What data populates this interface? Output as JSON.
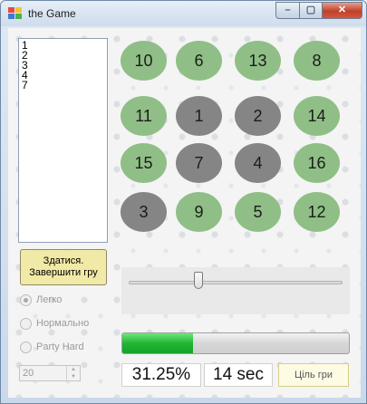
{
  "window": {
    "title": "the Game",
    "minimize_label": "–",
    "maximize_label": "▢",
    "close_label": "✕"
  },
  "moves_list": [
    "1",
    "2",
    "3",
    "4",
    "7"
  ],
  "board": {
    "tiles": [
      {
        "label": "10",
        "state": "active"
      },
      {
        "label": "6",
        "state": "active"
      },
      {
        "label": "13",
        "state": "active"
      },
      {
        "label": "8",
        "state": "active"
      },
      {
        "label": "11",
        "state": "active"
      },
      {
        "label": "1",
        "state": "placed"
      },
      {
        "label": "2",
        "state": "placed"
      },
      {
        "label": "14",
        "state": "active"
      },
      {
        "label": "15",
        "state": "active"
      },
      {
        "label": "7",
        "state": "placed"
      },
      {
        "label": "4",
        "state": "placed"
      },
      {
        "label": "16",
        "state": "active"
      },
      {
        "label": "3",
        "state": "placed"
      },
      {
        "label": "9",
        "state": "active"
      },
      {
        "label": "5",
        "state": "active"
      },
      {
        "label": "12",
        "state": "active"
      }
    ],
    "colors": {
      "active": "#8fbf86",
      "placed": "#858585"
    }
  },
  "giveup_button": {
    "line1": "Здатися.",
    "line2": "Завершити гру"
  },
  "difficulty": {
    "options": [
      "Легко",
      "Нормально",
      "Party Hard"
    ],
    "selected": "Легко",
    "enabled": false
  },
  "size_spinner": {
    "value": "20"
  },
  "speed_slider": {
    "value_fraction": 0.32
  },
  "progress": {
    "fraction": 0.3125
  },
  "stats": {
    "percent": "31.25%",
    "time": "14 sec"
  },
  "goal_button": {
    "label": "Ціль гри"
  }
}
